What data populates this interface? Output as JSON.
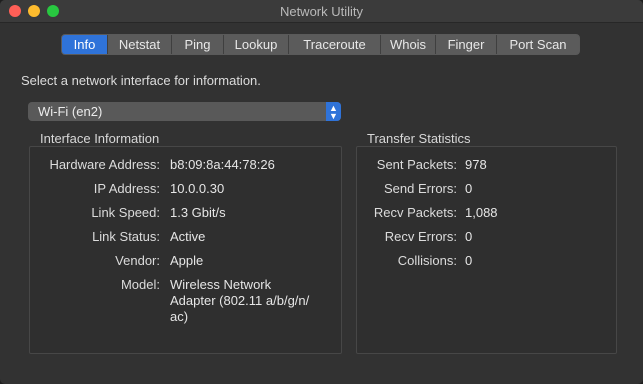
{
  "window": {
    "title": "Network Utility"
  },
  "tabs": [
    {
      "label": "Info"
    },
    {
      "label": "Netstat"
    },
    {
      "label": "Ping"
    },
    {
      "label": "Lookup"
    },
    {
      "label": "Traceroute"
    },
    {
      "label": "Whois"
    },
    {
      "label": "Finger"
    },
    {
      "label": "Port Scan"
    }
  ],
  "info": {
    "prompt": "Select a network interface for information.",
    "interface_select": {
      "selected": "Wi-Fi (en2)"
    },
    "interface_info": {
      "title": "Interface Information",
      "rows": [
        {
          "label": "Hardware Address:",
          "value": "b8:09:8a:44:78:26"
        },
        {
          "label": "IP Address:",
          "value": "10.0.0.30"
        },
        {
          "label": "Link Speed:",
          "value": "1.3 Gbit/s"
        },
        {
          "label": "Link Status:",
          "value": "Active"
        },
        {
          "label": "Vendor:",
          "value": "Apple"
        },
        {
          "label": "Model:",
          "value_lines": [
            "Wireless Network",
            "Adapter (802.11 a/b/g/n/",
            "ac)"
          ]
        }
      ]
    },
    "transfer_stats": {
      "title": "Transfer Statistics",
      "rows": [
        {
          "label": "Sent Packets:",
          "value": "978"
        },
        {
          "label": "Send Errors:",
          "value": "0"
        },
        {
          "label": "Recv Packets:",
          "value": "1,088"
        },
        {
          "label": "Recv Errors:",
          "value": "0"
        },
        {
          "label": "Collisions:",
          "value": "0"
        }
      ]
    }
  }
}
